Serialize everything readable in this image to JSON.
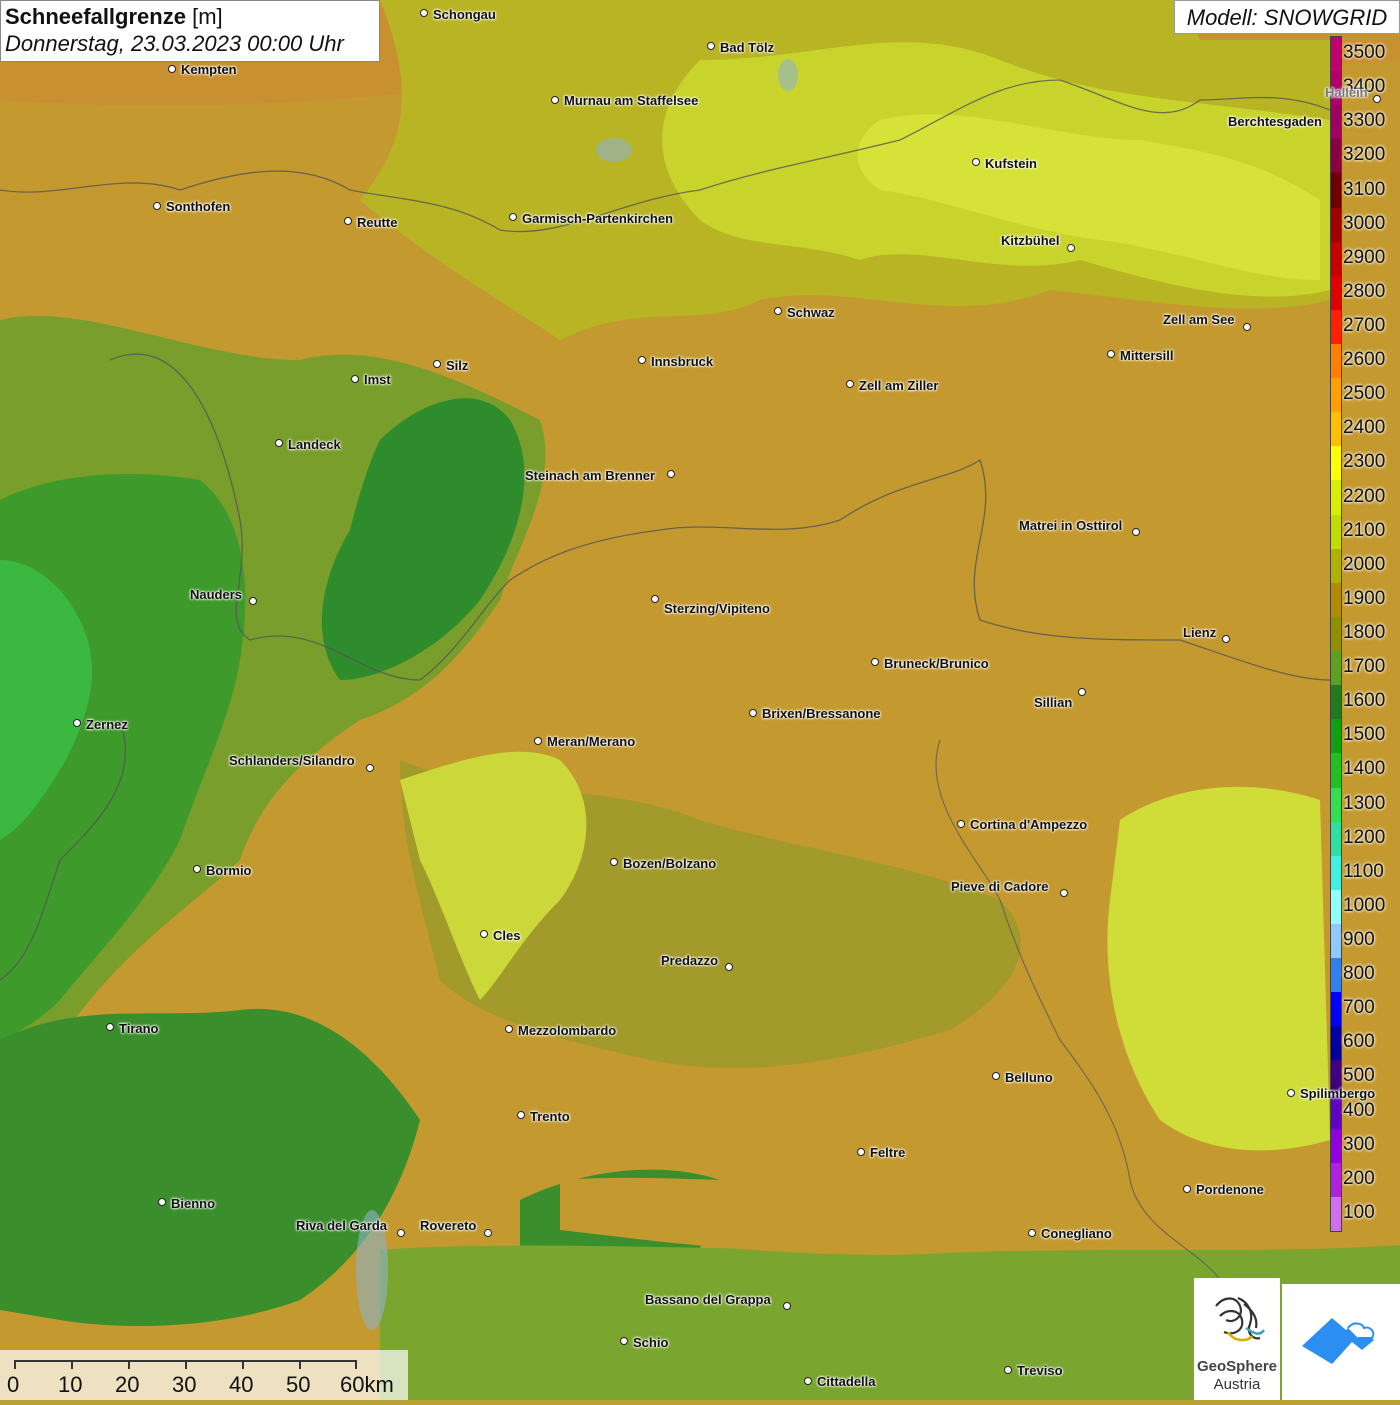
{
  "title": {
    "main": "Schneefallgrenze",
    "unit": "[m]",
    "date": "Donnerstag, 23.03.2023 00:00 Uhr"
  },
  "model": "Modell: SNOWGRID",
  "legend": {
    "labels": [
      "3500",
      "3400",
      "3300",
      "3200",
      "3100",
      "3000",
      "2900",
      "2800",
      "2700",
      "2600",
      "2500",
      "2400",
      "2300",
      "2200",
      "2100",
      "2000",
      "1900",
      "1800",
      "1700",
      "1600",
      "1500",
      "1400",
      "1300",
      "1200",
      "1100",
      "1000",
      "900",
      "800",
      "700",
      "600",
      "500",
      "400",
      "300",
      "200",
      "100"
    ],
    "colors": [
      "#c2006e",
      "#b0006a",
      "#a00060",
      "#8a0040",
      "#6e0000",
      "#a00000",
      "#c80000",
      "#e00000",
      "#ff2000",
      "#ff8000",
      "#ffa000",
      "#ffc000",
      "#ffff00",
      "#d8f000",
      "#c0dc00",
      "#b0b000",
      "#b08a00",
      "#909000",
      "#60a020",
      "#207a20",
      "#10a010",
      "#20c020",
      "#30e050",
      "#30e0a0",
      "#40f0e0",
      "#90ffff",
      "#90c8ff",
      "#3080f0",
      "#0000ff",
      "#0000a0",
      "#400080",
      "#6000c0",
      "#9000e0",
      "#b020e0",
      "#d070f0"
    ]
  },
  "places": [
    {
      "name": "Schongau"
    },
    {
      "name": "Kempten"
    },
    {
      "name": "Bad Tölz"
    },
    {
      "name": "Murnau am Staffelsee"
    },
    {
      "name": "Hallein"
    },
    {
      "name": "Berchtesgaden"
    },
    {
      "name": "Kufstein"
    },
    {
      "name": "Sonthofen"
    },
    {
      "name": "Reutte"
    },
    {
      "name": "Garmisch-Partenkirchen"
    },
    {
      "name": "Kitzbühel"
    },
    {
      "name": "Schwaz"
    },
    {
      "name": "Zell am See"
    },
    {
      "name": "Innsbruck"
    },
    {
      "name": "Mittersill"
    },
    {
      "name": "Imst"
    },
    {
      "name": "Silz"
    },
    {
      "name": "Zell am Ziller"
    },
    {
      "name": "Landeck"
    },
    {
      "name": "Steinach am Brenner"
    },
    {
      "name": "Matrei in Osttirol"
    },
    {
      "name": "Nauders"
    },
    {
      "name": "Sterzing/Vipiteno"
    },
    {
      "name": "Lienz"
    },
    {
      "name": "Bruneck/Brunico"
    },
    {
      "name": "Zernez"
    },
    {
      "name": "Sillian"
    },
    {
      "name": "Brixen/Bressanone"
    },
    {
      "name": "Meran/Merano"
    },
    {
      "name": "Schlanders/Silandro"
    },
    {
      "name": "Cortina d'Ampezzo"
    },
    {
      "name": "Bozen/Bolzano"
    },
    {
      "name": "Bormio"
    },
    {
      "name": "Pieve di Cadore"
    },
    {
      "name": "Cles"
    },
    {
      "name": "Predazzo"
    },
    {
      "name": "Tirano"
    },
    {
      "name": "Mezzolombardo"
    },
    {
      "name": "Belluno"
    },
    {
      "name": "Spilimbergo"
    },
    {
      "name": "Trento"
    },
    {
      "name": "Feltre"
    },
    {
      "name": "Pordenone"
    },
    {
      "name": "Bienno"
    },
    {
      "name": "Riva del Garda"
    },
    {
      "name": "Rovereto"
    },
    {
      "name": "Conegliano"
    },
    {
      "name": "Bassano del Grappa"
    },
    {
      "name": "Schio"
    },
    {
      "name": "Treviso"
    },
    {
      "name": "Cittadella"
    }
  ],
  "scale": {
    "labels": [
      "0",
      "10",
      "20",
      "30",
      "40",
      "50",
      "60km"
    ]
  },
  "logo": {
    "name": "GeoSphere",
    "sub": "Austria"
  }
}
